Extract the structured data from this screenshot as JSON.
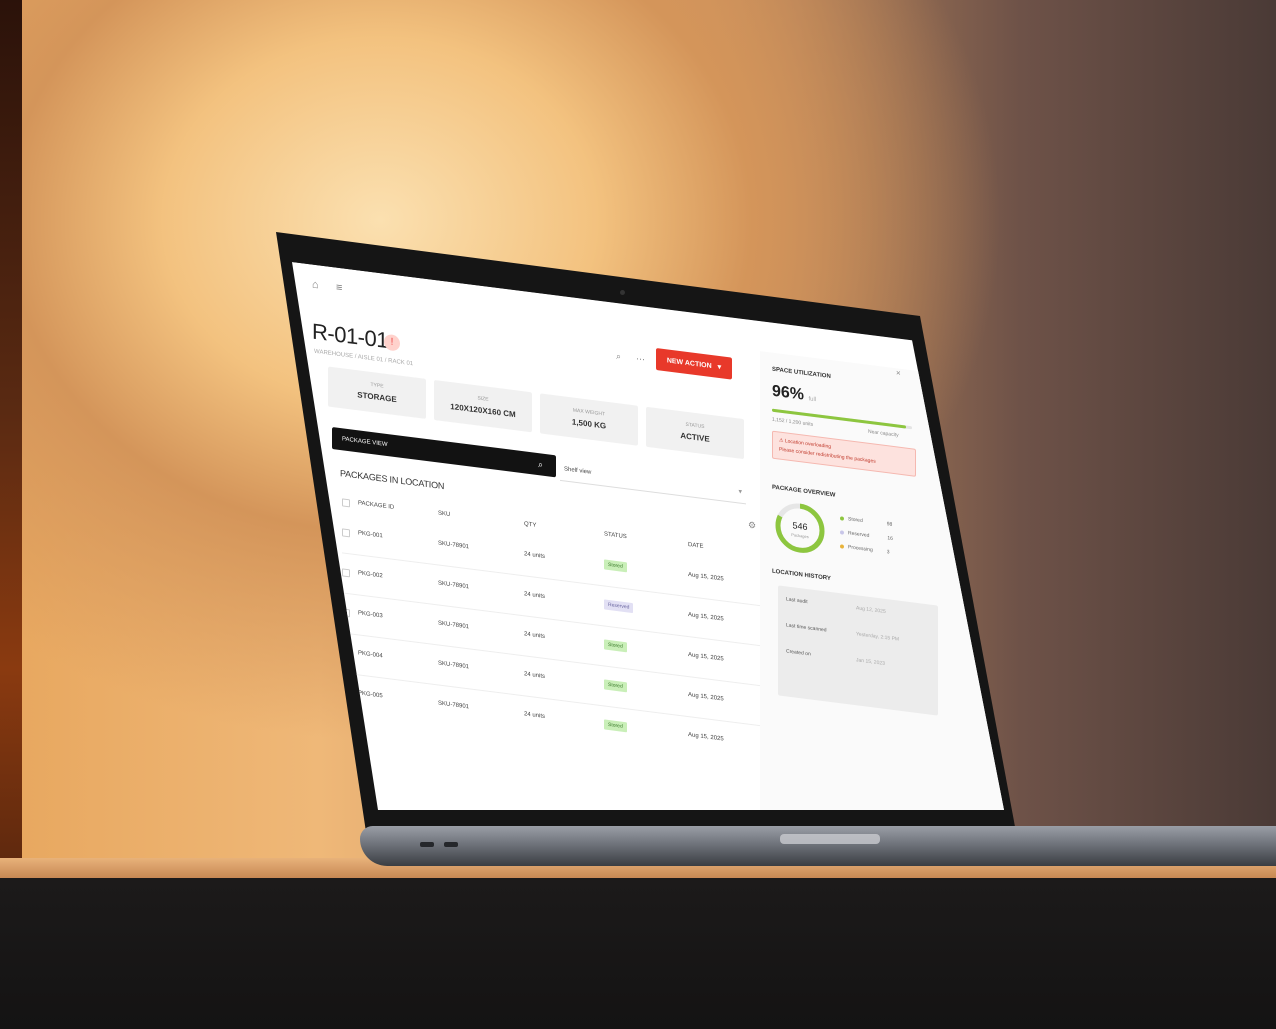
{
  "app": {
    "title": "R-01-01",
    "subtitle": "WAREHOUSE / AISLE 01 / RACK 01",
    "action_button": "NEW ACTION",
    "topbar_icons": [
      "back-icon",
      "menu-icon"
    ]
  },
  "stats": [
    {
      "label": "TYPE",
      "value": "STORAGE"
    },
    {
      "label": "SIZE",
      "value": "120X120X160 CM"
    },
    {
      "label": "MAX WEIGHT",
      "value": "1,500 KG"
    },
    {
      "label": "STATUS",
      "value": "ACTIVE"
    }
  ],
  "search": {
    "label": "PACKAGE VIEW",
    "filter_value": "Shelf view"
  },
  "packages": {
    "title": "PACKAGES IN LOCATION",
    "columns": [
      "PACKAGE ID",
      "SKU",
      "QTY",
      "STATUS",
      "DATE"
    ],
    "rows": [
      {
        "id": "PKG-001",
        "sku": "SKU-78901",
        "qty": "24 units",
        "status": "Stored",
        "status_kind": "ok",
        "date": "Aug 15, 2025"
      },
      {
        "id": "PKG-002",
        "sku": "SKU-78901",
        "qty": "24 units",
        "status": "Reserved",
        "status_kind": "warn",
        "date": "Aug 15, 2025"
      },
      {
        "id": "PKG-003",
        "sku": "SKU-78901",
        "qty": "24 units",
        "status": "Stored",
        "status_kind": "ok",
        "date": "Aug 15, 2025"
      },
      {
        "id": "PKG-004",
        "sku": "SKU-78901",
        "qty": "24 units",
        "status": "Stored",
        "status_kind": "ok",
        "date": "Aug 15, 2025"
      },
      {
        "id": "PKG-005",
        "sku": "SKU-78901",
        "qty": "24 units",
        "status": "Stored",
        "status_kind": "ok",
        "date": "Aug 15, 2025"
      }
    ]
  },
  "side": {
    "utilization_title": "SPACE UTILIZATION",
    "utilization_value": "96%",
    "utilization_unit": "full",
    "utilization_fraction": 0.96,
    "used_label": "1,152 / 1,200 units",
    "capacity_note": "Near capacity",
    "alert_title": "Location overloading",
    "alert_text": "Please consider redistributing the packages",
    "packages_overview_title": "PACKAGE OVERVIEW",
    "donut_value": "546",
    "donut_label": "Packages",
    "legend": [
      {
        "label": "Stored",
        "value": "98",
        "color": "#8dc63f"
      },
      {
        "label": "Reserved",
        "value": "16",
        "color": "#c8c6e8"
      },
      {
        "label": "Processing",
        "value": "3",
        "color": "#e8b33a"
      }
    ],
    "history_title": "LOCATION HISTORY",
    "history": [
      {
        "label": "Last audit",
        "value": "Aug 12, 2025"
      },
      {
        "label": "Last time scanned",
        "value": "Yesterday, 2:15 PM"
      },
      {
        "label": "Created on",
        "value": "Jan 15, 2023"
      }
    ],
    "close_icon": "close-icon"
  }
}
